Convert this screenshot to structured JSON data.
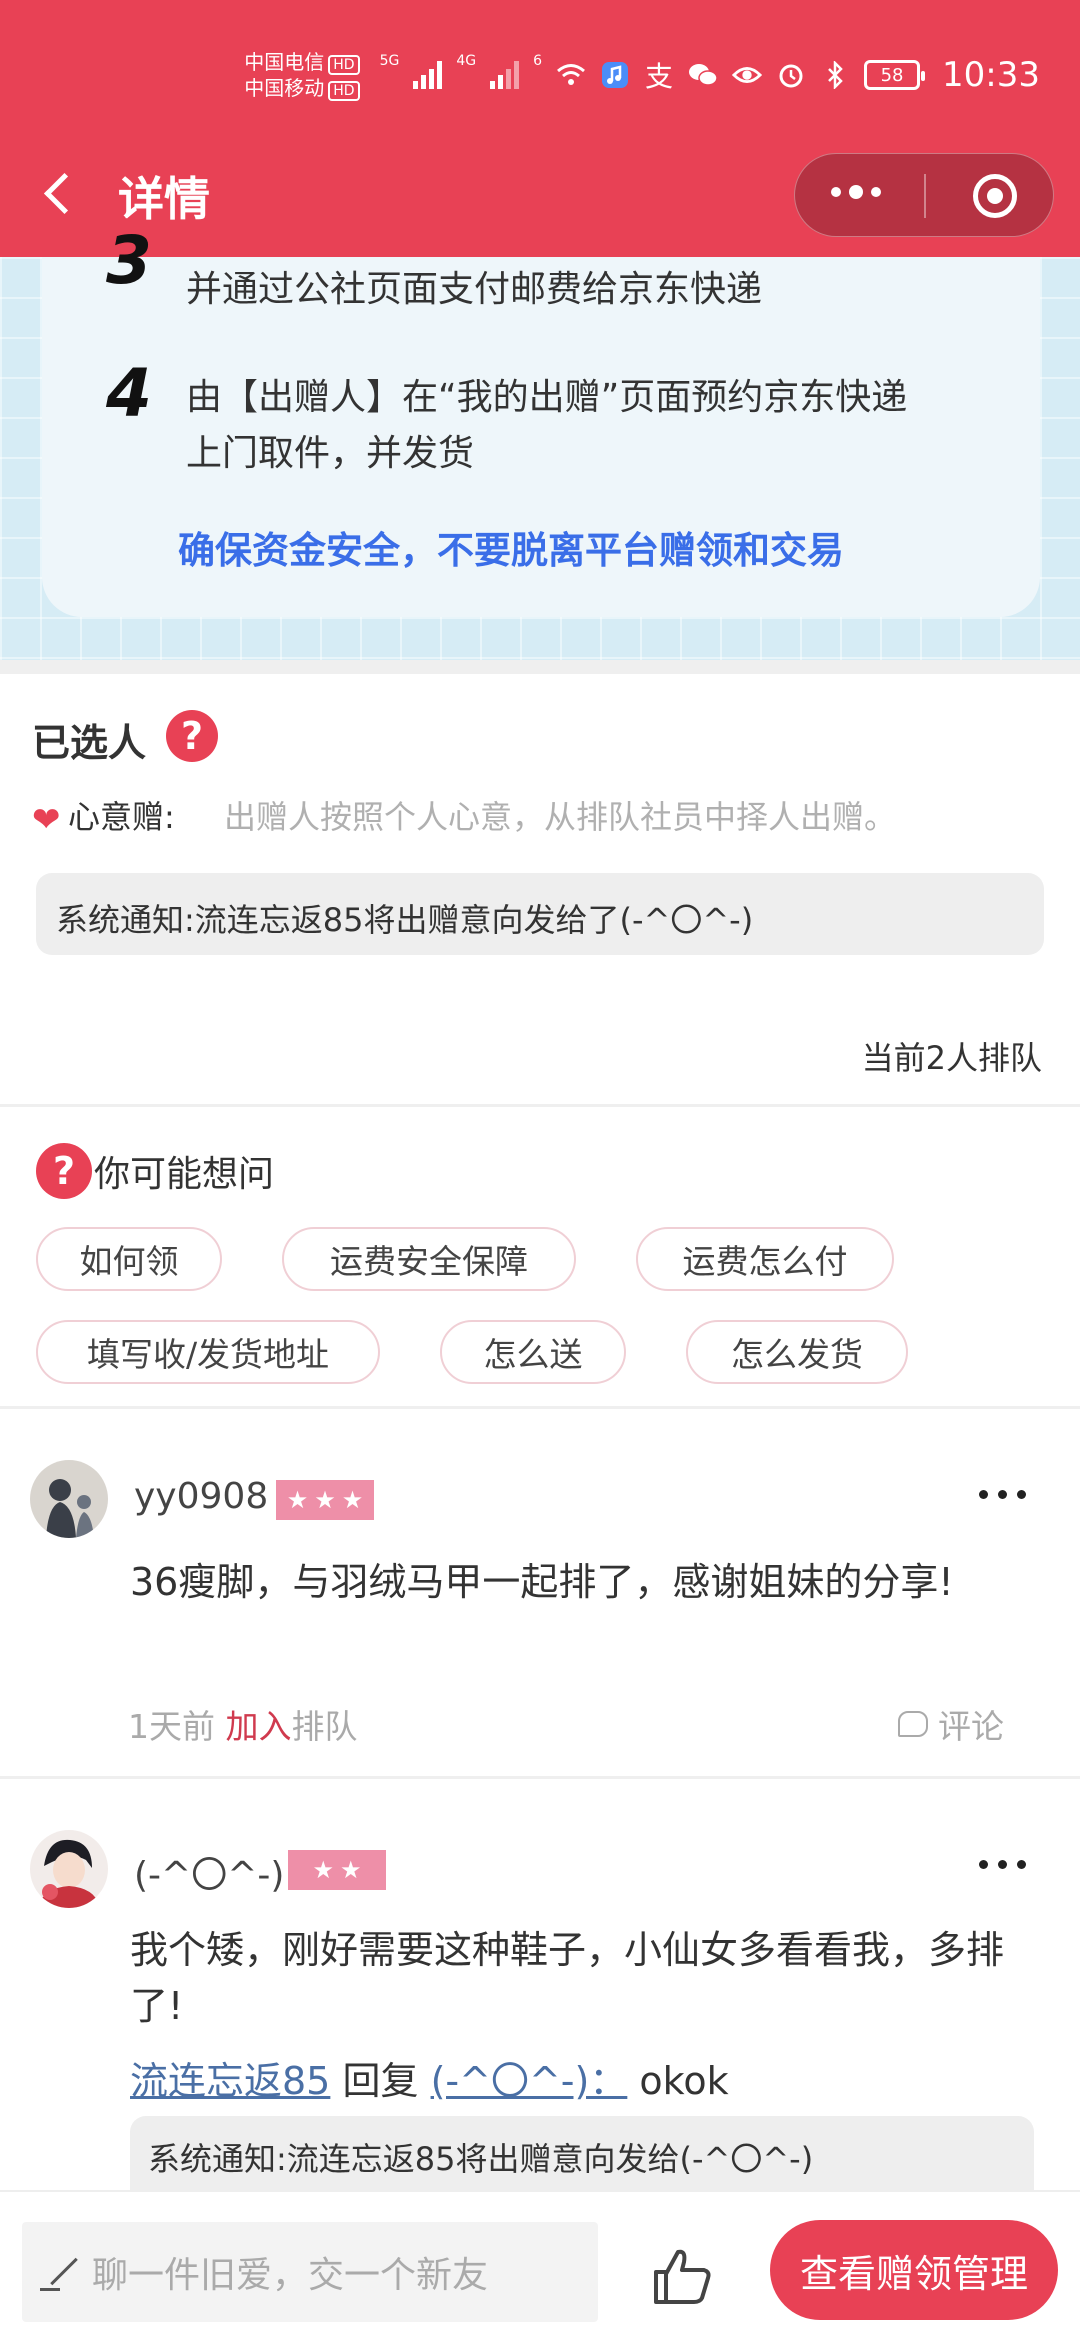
{
  "status_bar": {
    "carrier1": "中国电信",
    "carrier2": "中国移动",
    "hd": "HD",
    "net1": "5G",
    "net2": "4G",
    "wifi_sup": "6",
    "battery": "58",
    "time": "10:33"
  },
  "nav": {
    "title": "详情"
  },
  "steps": [
    {
      "num": "3",
      "text": "并通过公社页面支付邮费给京东快递"
    },
    {
      "num": "4",
      "text_line1": "由【出赠人】在“我的出赠”页面预约京东快递",
      "text_line2": "上门取件，并发货"
    }
  ],
  "safety_text": "确保资金安全，不要脱离平台赠领和交易",
  "selected": {
    "title": "已选人",
    "help_icon": "?",
    "mode_label": "心意赠:",
    "mode_desc": "出赠人按照个人心意，从排队社员中择人出赠。",
    "notice": "系统通知:流连忘返85将出赠意向发给了(-^〇^-)",
    "queue": "当前2人排队"
  },
  "faq": {
    "title": "你可能想问",
    "icon": "?",
    "tags": [
      "如何领",
      "运费安全保障",
      "运费怎么付",
      "填写收/发货地址",
      "怎么送",
      "怎么发货"
    ]
  },
  "posts": [
    {
      "username": "yy0908",
      "stars": "★★★",
      "text": "36瘦脚，与羽绒马甲一起排了，感谢姐妹的分享!",
      "time": "1天前",
      "join": "加入",
      "queue_word": "排队",
      "comment_label": "评论"
    },
    {
      "username": "(-^〇^-)",
      "stars": "★★",
      "text": "我个矮，刚好需要这种鞋子，小仙女多看看我，多排了!",
      "reply_user": "流连忘返85",
      "reply_word": "回复",
      "reply_target": "(-^〇^-)：",
      "reply_text": "okok",
      "notice": "系统通知:流连忘返85将出赠意向发给(-^〇^-)"
    }
  ],
  "bottom": {
    "input_placeholder": "聊一件旧爱，交一个新友",
    "cta": "查看赠领管理"
  },
  "colors": {
    "brand": "#E84155",
    "link": "#3a6ee8",
    "star_badge": "#EE8FA8"
  }
}
